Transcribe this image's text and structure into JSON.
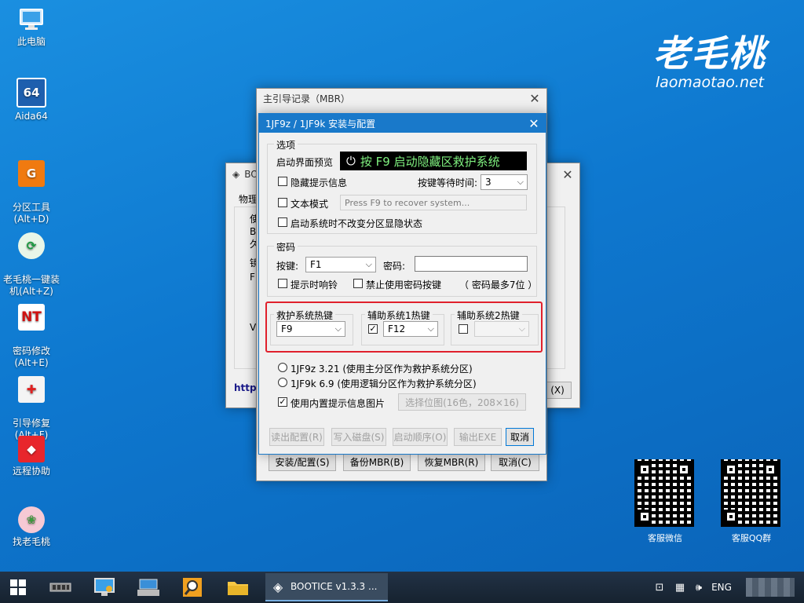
{
  "desktop": {
    "icons": [
      {
        "label": "此电脑",
        "icon": "computer-icon"
      },
      {
        "label": "Aida64",
        "icon": "aida64-icon",
        "glyph": "64"
      },
      {
        "label": "分区工具\n(Alt+D)",
        "icon": "partition-tool-icon"
      },
      {
        "label": "老毛桃一键装\n机(Alt+Z)",
        "icon": "one-key-install-icon"
      },
      {
        "label": "密码修改\n(Alt+E)",
        "icon": "password-change-icon"
      },
      {
        "label": "引导修复\n(Alt+F)",
        "icon": "boot-repair-icon"
      },
      {
        "label": "远程协助",
        "icon": "remote-assist-icon"
      },
      {
        "label": "找老毛桃",
        "icon": "find-laomaotao-icon"
      }
    ],
    "brand": {
      "cn": "老毛桃",
      "en": "laomaotao.net"
    },
    "qr": [
      {
        "label": "客服微信"
      },
      {
        "label": "客服QQ群"
      }
    ]
  },
  "bootice": {
    "title": "BO",
    "tab": "物理",
    "labels": [
      "使",
      "B",
      "久",
      "镜",
      "F",
      "VH",
      "http:"
    ],
    "btn_fragment": "(X)"
  },
  "mbr_window": {
    "title": "主引导记录（MBR）",
    "buttons": [
      "安装/配置(S)",
      "备份MBR(B)",
      "恢复MBR(R)",
      "取消(C)"
    ]
  },
  "dialog": {
    "title": "1JF9z / 1JF9k 安装与配置",
    "options": {
      "group_title": "选项",
      "preview_label": "启动界面预览",
      "preview_text": "按 F9 启动隐藏区救护系统",
      "hide_tip": "隐藏提示信息",
      "wait_label": "按键等待时间:",
      "wait_value": "3",
      "text_mode": "文本模式",
      "text_mode_placeholder": "Press F9 to recover system...",
      "no_change": "启动系统时不改变分区显隐状态"
    },
    "password": {
      "group_title": "密码",
      "key_label": "按键:",
      "key_value": "F1",
      "pw_label": "密码:",
      "pw_value": "",
      "beep": "提示时响铃",
      "disable_pw_key": "禁止使用密码按键",
      "max_hint": "（ 密码最多7位 ）"
    },
    "hotkeys": {
      "rescue_title": "救护系统热键",
      "rescue_value": "F9",
      "aux1_title": "辅助系统1热键",
      "aux1_checked": true,
      "aux1_value": "F12",
      "aux2_title": "辅助系统2热键",
      "aux2_checked": false,
      "aux2_value": ""
    },
    "radio1": "1JF9z 3.21 (使用主分区作为救护系统分区)",
    "radio2": "1JF9k 6.9 (使用逻辑分区作为救护系统分区)",
    "builtin_img": "使用内置提示信息图片",
    "select_bitmap": "选择位图(16色，208×16)",
    "footer_buttons": [
      "读出配置(R)",
      "写入磁盘(S)",
      "启动顺序(O)",
      "输出EXE",
      "取消"
    ],
    "highlight_color": "#e0202c"
  },
  "taskbar": {
    "task_label": "BOOTICE v1.3.3 ...",
    "lang": "ENG"
  }
}
